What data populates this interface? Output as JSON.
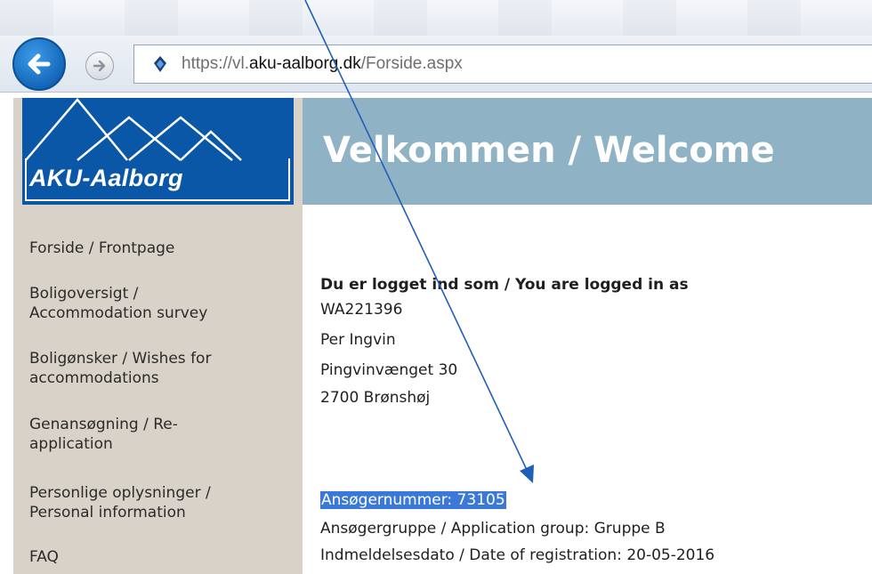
{
  "browser": {
    "url_scheme": "https://",
    "url_host_pre": "vl.",
    "url_host_main": "aku-aalborg.dk",
    "url_path": "/Forside.aspx",
    "back_icon": "arrow-left-icon",
    "forward_icon": "arrow-right-icon",
    "site_icon": "lock-icon"
  },
  "logo": {
    "text": "AKU-Aalborg"
  },
  "header": {
    "title": "Velkommen / Welcome"
  },
  "sidebar": {
    "items": [
      {
        "line1": "Forside / Frontpage",
        "line2": ""
      },
      {
        "line1": "Boligoversigt /",
        "line2": "Accommodation survey"
      },
      {
        "line1": "Boligønsker / Wishes for",
        "line2": "accommodations"
      },
      {
        "line1": "Genansøgning / Re-",
        "line2": "application"
      },
      {
        "line1": "Personlige oplysninger /",
        "line2": "Personal information"
      },
      {
        "line1": "FAQ",
        "line2": ""
      }
    ]
  },
  "main": {
    "logged_in_heading": "Du er logget ind som / You are logged in as",
    "user_id": "WA221396",
    "name": "Per Ingvin",
    "street": "Pingvinvænget 30",
    "city": "2700 Brønshøj",
    "applicant_number": "Ansøgernummer: 73105",
    "application_group": "Ansøgergruppe / Application group: Gruppe B",
    "registration_date": "Indmeldelsesdato / Date of registration: 20-05-2016"
  },
  "colors": {
    "logo_bg": "#0a57a8",
    "header_bg": "#8fb2c4",
    "sidebar_bg": "#d8d2c8",
    "highlight": "#3b79d9",
    "annotation_arrow": "#1f5fb8"
  }
}
